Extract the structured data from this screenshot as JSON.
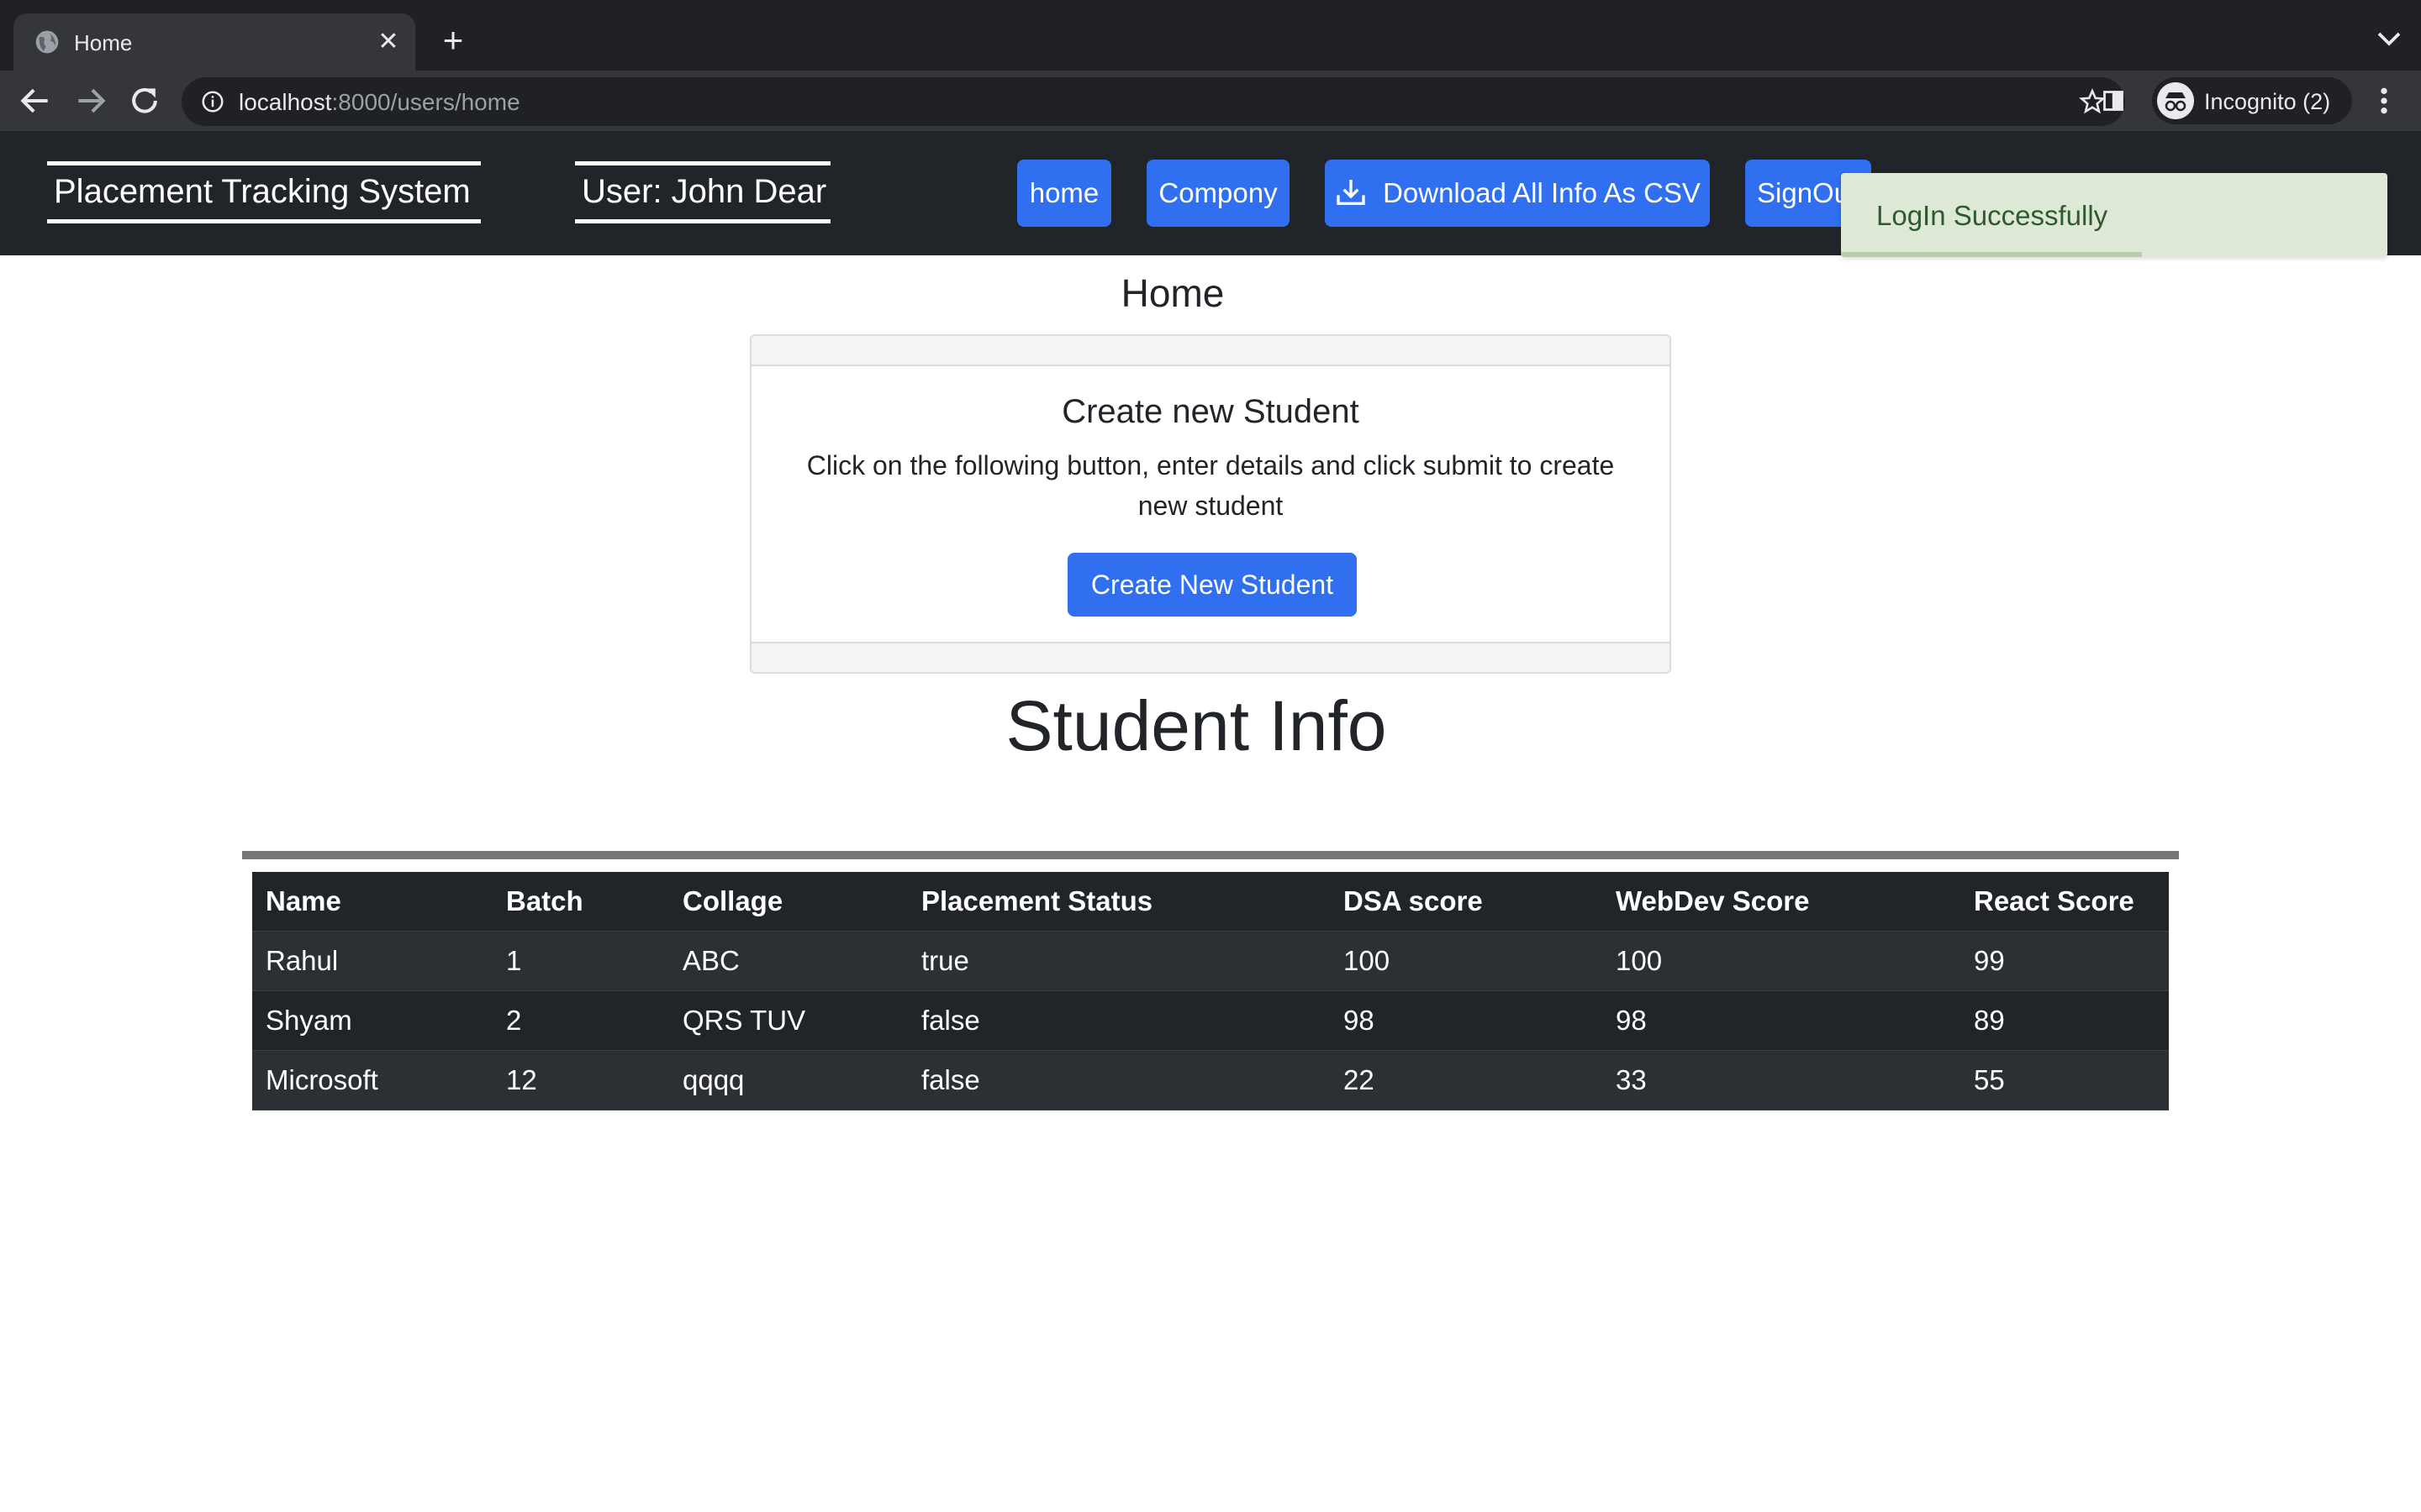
{
  "browser": {
    "tab_title": "Home",
    "url_host": "localhost",
    "url_rest": ":8000/users/home",
    "incognito_label": "Incognito (2)"
  },
  "navbar": {
    "brand": "Placement Tracking System",
    "user": "User: John Dear",
    "home": "home",
    "company": "Compony",
    "download": "Download All Info As CSV",
    "signout": "SignOut"
  },
  "toast": {
    "message": "LogIn Successfully",
    "progress": 0.55,
    "color": "#dde9d6"
  },
  "main": {
    "page_title": "Home",
    "card": {
      "title": "Create new Student",
      "text": "Click on the following button, enter details and click submit to create new student",
      "button": "Create New Student"
    },
    "section_title": "Student Info"
  },
  "table": {
    "headers": [
      "Name",
      "Batch",
      "Collage",
      "Placement Status",
      "DSA score",
      "WebDev Score",
      "React Score"
    ],
    "rows": [
      [
        "Rahul",
        "1",
        "ABC",
        "true",
        "100",
        "100",
        "99"
      ],
      [
        "Shyam",
        "2",
        "QRS TUV",
        "false",
        "98",
        "98",
        "89"
      ],
      [
        "Microsoft",
        "12",
        "qqqq",
        "false",
        "22",
        "33",
        "55"
      ]
    ]
  },
  "colors": {
    "primary_button": "#2f6ff0",
    "navbar_bg": "#212529",
    "chrome_bg": "#202124"
  }
}
